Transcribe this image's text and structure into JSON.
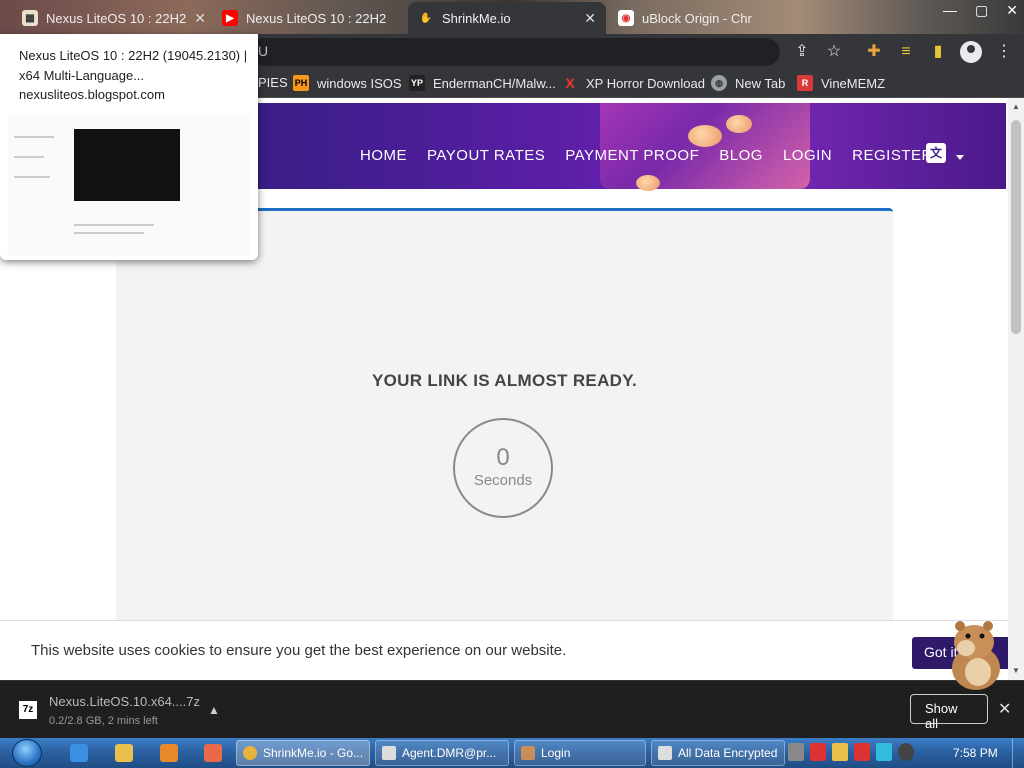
{
  "browser": {
    "tabs": [
      {
        "title": "Nexus LiteOS 10 : 22H2",
        "active": false
      },
      {
        "title": "Nexus LiteOS 10 : 22H2",
        "active": false
      },
      {
        "title": "ShrinkMe.io",
        "active": true
      },
      {
        "title": "uBlock Origin - Chr",
        "active": false
      }
    ],
    "omnibox_partial": "U",
    "bookmarks": [
      {
        "label": "PIES",
        "icon": "bookmark-icon"
      },
      {
        "label": "windows ISOS",
        "icon": "ph-icon"
      },
      {
        "label": "EndermanCH/Malw...",
        "icon": "yp-icon"
      },
      {
        "label": "XP Horror Download",
        "icon": "x-icon"
      },
      {
        "label": "New Tab",
        "icon": "globe-icon"
      },
      {
        "label": "VineMEMZ",
        "icon": "r-icon"
      }
    ]
  },
  "tab_preview": {
    "title": "Nexus LiteOS 10 : 22H2 (19045.2130) | x64 Multi-Language...",
    "url": "nexusliteos.blogspot.com"
  },
  "site": {
    "nav": [
      "HOME",
      "PAYOUT RATES",
      "PAYMENT PROOF",
      "BLOG",
      "LOGIN",
      "REGISTER"
    ],
    "heading": "YOUR LINK IS ALMOST READY.",
    "timer_value": "0",
    "timer_label": "Seconds",
    "cookie_message": "This website uses cookies to ensure you get the best experience on our website.",
    "cookie_button": "Got it"
  },
  "download": {
    "file_name": "Nexus.LiteOS.10.x64....7z",
    "progress": "0.2/2.8 GB, 2 mins left",
    "show_all": "Show all"
  },
  "taskbar": {
    "buttons": [
      {
        "label": "ShrinkMe.io - Go...",
        "active": true
      },
      {
        "label": "Agent.DMR@pr...",
        "active": false
      },
      {
        "label": "Login",
        "active": false
      },
      {
        "label": "All Data Encrypted",
        "active": false
      }
    ],
    "clock": "7:58 PM"
  }
}
